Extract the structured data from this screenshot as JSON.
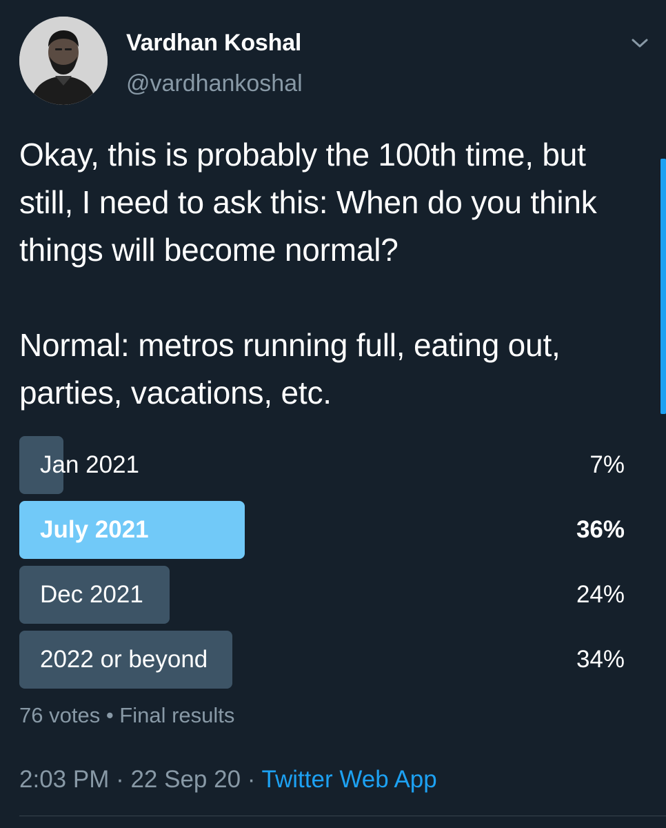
{
  "author": {
    "display_name": "Vardhan Koshal",
    "handle": "@vardhankoshal",
    "avatar": "profile-photo"
  },
  "menu_icon": "chevron-down-icon",
  "tweet": {
    "paragraphs": [
      "Okay, this is probably the 100th time, but still, I need to ask this: When do you think things will become normal?",
      "Normal: metros running full, eating out, parties, vacations, etc."
    ]
  },
  "poll": {
    "options": [
      {
        "label": "Jan 2021",
        "percent_text": "7%",
        "percent": 7,
        "winner": false
      },
      {
        "label": "July 2021",
        "percent_text": "36%",
        "percent": 36,
        "winner": true
      },
      {
        "label": "Dec 2021",
        "percent_text": "24%",
        "percent": 24,
        "winner": false
      },
      {
        "label": "2022 or beyond",
        "percent_text": "34%",
        "percent": 34,
        "winner": false
      }
    ],
    "votes": "76 votes",
    "separator": " • ",
    "status": "Final results"
  },
  "meta": {
    "time": "2:03 PM",
    "date": "22 Sep 20",
    "separator": " · ",
    "source": "Twitter Web App"
  },
  "colors": {
    "background": "#15202b",
    "bar": "#3d5466",
    "winner_bar": "#71c9f8",
    "link": "#1da1f2",
    "muted_text": "#8899a6"
  }
}
